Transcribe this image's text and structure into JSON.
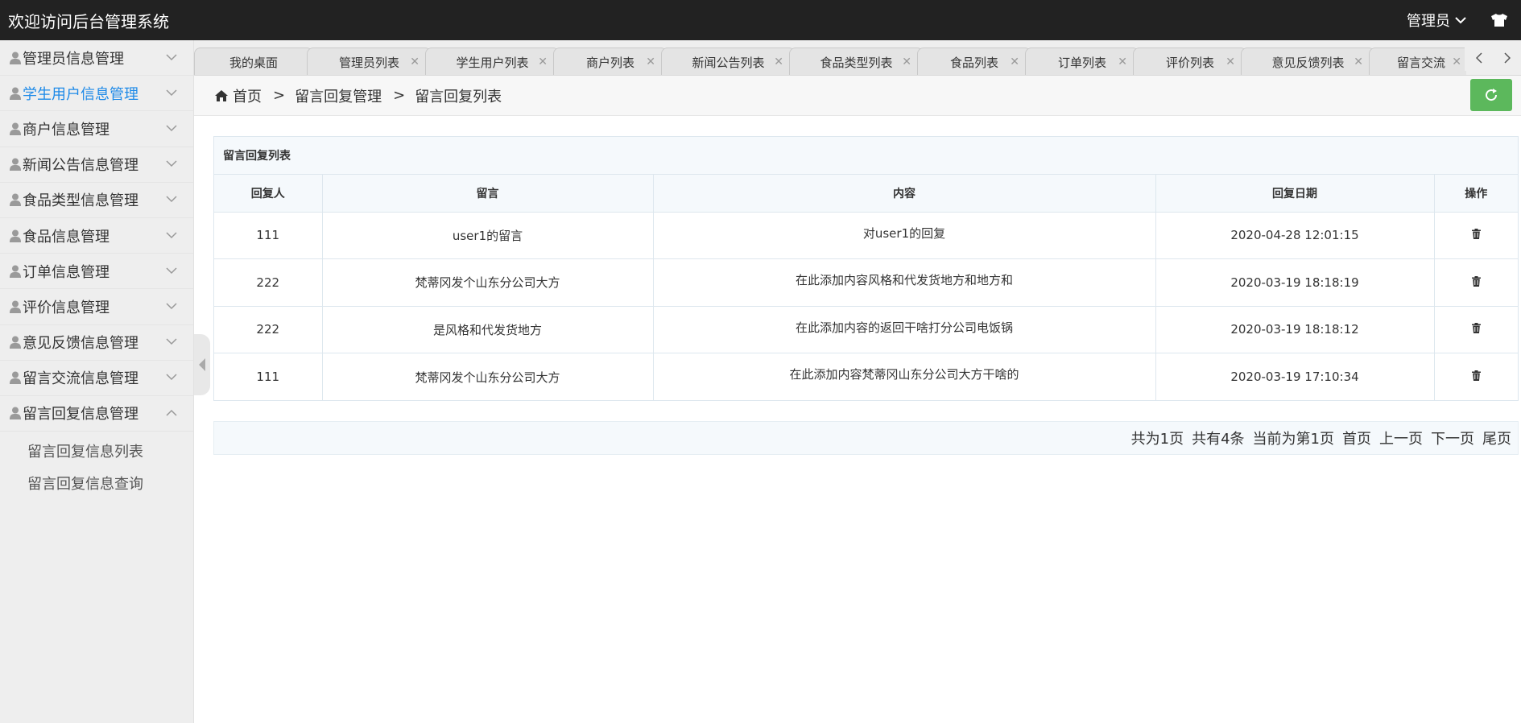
{
  "header": {
    "title": "欢迎访问后台管理系统",
    "user_label": "管理员"
  },
  "sidebar": {
    "items": [
      {
        "label": "管理员信息管理",
        "active": false
      },
      {
        "label": "学生用户信息管理",
        "active": true
      },
      {
        "label": "商户信息管理",
        "active": false
      },
      {
        "label": "新闻公告信息管理",
        "active": false
      },
      {
        "label": "食品类型信息管理",
        "active": false
      },
      {
        "label": "食品信息管理",
        "active": false
      },
      {
        "label": "订单信息管理",
        "active": false
      },
      {
        "label": "评价信息管理",
        "active": false
      },
      {
        "label": "意见反馈信息管理",
        "active": false
      },
      {
        "label": "留言交流信息管理",
        "active": false
      },
      {
        "label": "留言回复信息管理",
        "active": false,
        "expanded": true
      }
    ],
    "subitems": [
      "留言回复信息列表",
      "留言回复信息查询"
    ]
  },
  "tabs": [
    {
      "label": "我的桌面",
      "closable": false
    },
    {
      "label": "管理员列表",
      "closable": true
    },
    {
      "label": "学生用户列表",
      "closable": true
    },
    {
      "label": "商户列表",
      "closable": true
    },
    {
      "label": "新闻公告列表",
      "closable": true
    },
    {
      "label": "食品类型列表",
      "closable": true
    },
    {
      "label": "食品列表",
      "closable": true
    },
    {
      "label": "订单列表",
      "closable": true
    },
    {
      "label": "评价列表",
      "closable": true
    },
    {
      "label": "意见反馈列表",
      "closable": true
    },
    {
      "label": "留言交流",
      "closable": true
    }
  ],
  "breadcrumb": {
    "home": "首页",
    "separator": ">",
    "level1": "留言回复管理",
    "level2": "留言回复列表"
  },
  "panel": {
    "title": "留言回复列表",
    "columns": [
      "回复人",
      "留言",
      "内容",
      "回复日期",
      "操作"
    ],
    "rows": [
      {
        "replier": "111",
        "message": "user1的留言",
        "content": "对user1的回复",
        "date": "2020-04-28 12:01:15"
      },
      {
        "replier": "222",
        "message": "梵蒂冈发个山东分公司大方",
        "content": "在此添加内容风格和代发货地方和地方和",
        "date": "2020-03-19 18:18:19"
      },
      {
        "replier": "222",
        "message": "是风格和代发货地方",
        "content": "在此添加内容的返回干啥打分公司电饭锅",
        "date": "2020-03-19 18:18:12"
      },
      {
        "replier": "111",
        "message": "梵蒂冈发个山东分公司大方",
        "content": "在此添加内容梵蒂冈山东分公司大方干啥的",
        "date": "2020-03-19 17:10:34"
      }
    ]
  },
  "pagination": {
    "total_pages": "共为1页",
    "total_records": "共有4条",
    "current": "当前为第1页",
    "first": "首页",
    "prev": "上一页",
    "next": "下一页",
    "last": "尾页"
  },
  "colors": {
    "header_bg": "#222222",
    "sidebar_bg": "#eeeeee",
    "active_menu": "#1e8ae8",
    "refresh_button": "#5cb85c"
  }
}
